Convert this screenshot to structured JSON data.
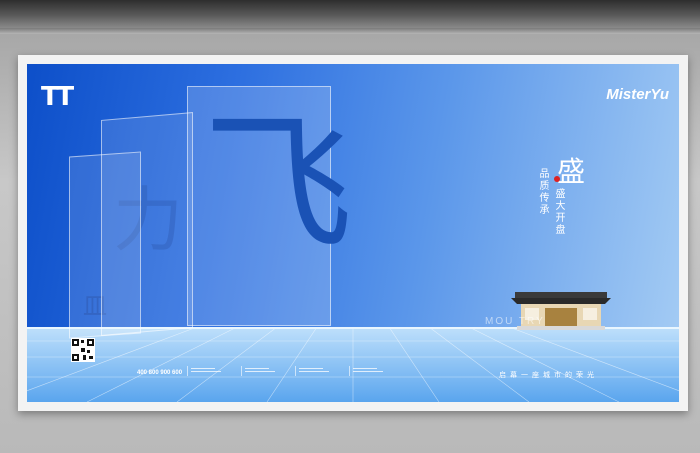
{
  "poster": {
    "logo_mark": "TT",
    "brand": "MisterYu",
    "hero_char": "飞",
    "ghost_chars": [
      "力",
      "皿"
    ],
    "vertical_left": "品质传承",
    "vertical_right": "盛大开盘",
    "accent_char": "盛",
    "ghost_caption": "MOU        TRY",
    "phone": "400 800 900 600",
    "tagline": "启幕一座城市的荣光"
  },
  "colors": {
    "accent_red": "#d22222",
    "brand_blue": "#1a52b5",
    "sky_light": "#a6cdf4"
  }
}
